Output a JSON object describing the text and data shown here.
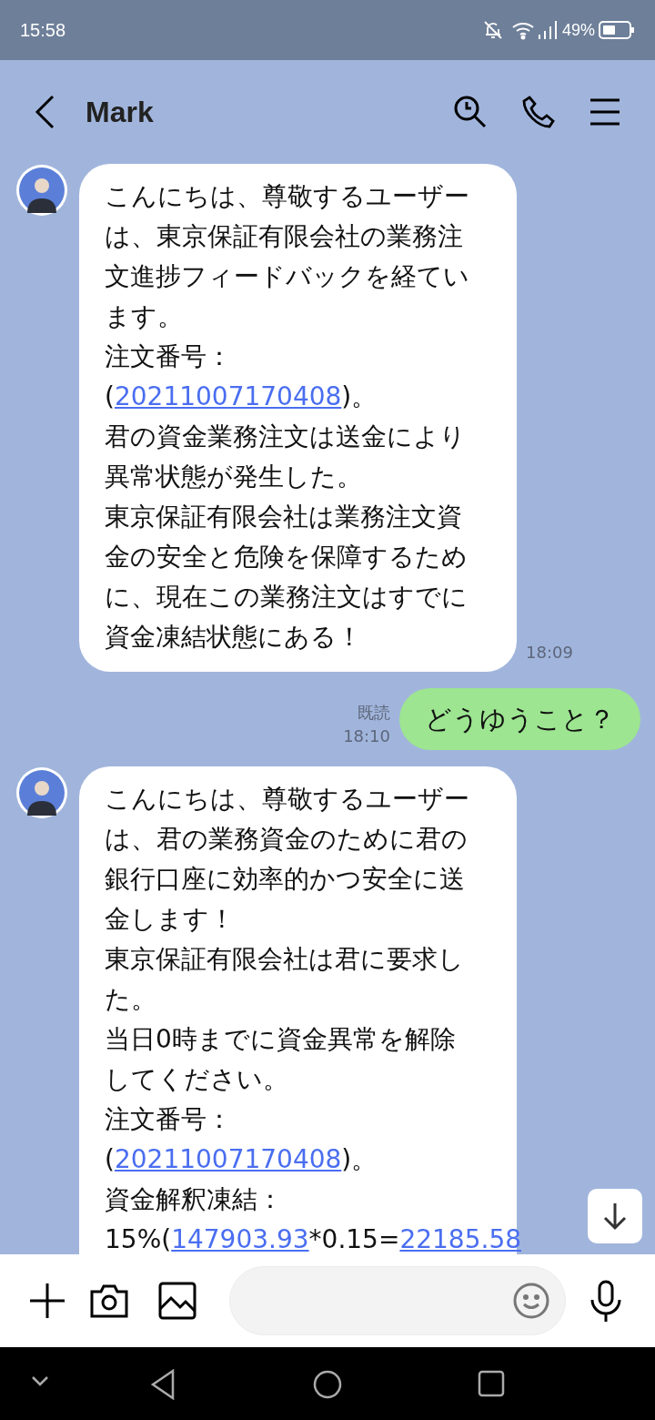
{
  "status_bar": {
    "time": "15:58",
    "battery": "49%"
  },
  "header": {
    "title": "Mark"
  },
  "messages": [
    {
      "kind": "incoming",
      "time": "18:09",
      "lines": [
        [
          {
            "text": "こんにちは、尊敬するユーザー"
          }
        ],
        [
          {
            "text": "は、東京保証有限会社の業務注"
          }
        ],
        [
          {
            "text": "文進捗フィードバックを経てい"
          }
        ],
        [
          {
            "text": "ます。"
          }
        ],
        [
          {
            "text": "注文番号："
          }
        ],
        [
          {
            "text": "("
          },
          {
            "text": "20211007170408",
            "link": true
          },
          {
            "text": ")。"
          }
        ],
        [
          {
            "text": "君の資金業務注文は送金により"
          }
        ],
        [
          {
            "text": "異常状態が発生した。"
          }
        ],
        [
          {
            "text": "東京保証有限会社は業務注文資"
          }
        ],
        [
          {
            "text": "金の安全と危険を保障するため"
          }
        ],
        [
          {
            "text": "に、現在この業務注文はすでに"
          }
        ],
        [
          {
            "text": "資金凍結状態にある！"
          }
        ]
      ]
    },
    {
      "kind": "outgoing",
      "read": "既読",
      "time": "18:10",
      "lines": [
        [
          {
            "text": "どうゆうこと？"
          }
        ]
      ]
    },
    {
      "kind": "incoming",
      "lines": [
        [
          {
            "text": "こんにちは、尊敬するユーザー"
          }
        ],
        [
          {
            "text": "は、君の業務資金のために君の"
          }
        ],
        [
          {
            "text": "銀行口座に効率的かつ安全に送"
          }
        ],
        [
          {
            "text": "金します！"
          }
        ],
        [
          {
            "text": "東京保証有限会社は君に要求し"
          }
        ],
        [
          {
            "text": "た。"
          }
        ],
        [
          {
            "text": "当日0時までに資金異常を解除"
          }
        ],
        [
          {
            "text": "してください。"
          }
        ],
        [
          {
            "text": "注文番号："
          }
        ],
        [
          {
            "text": "("
          },
          {
            "text": "20211007170408",
            "link": true
          },
          {
            "text": ")。"
          }
        ],
        [
          {
            "text": "資金解釈凍結："
          }
        ],
        [
          {
            "text": "15%("
          },
          {
            "text": "147903.93",
            "link": true
          },
          {
            "text": "*0.15="
          },
          {
            "text": "22185.58",
            "link": true
          }
        ]
      ]
    }
  ]
}
